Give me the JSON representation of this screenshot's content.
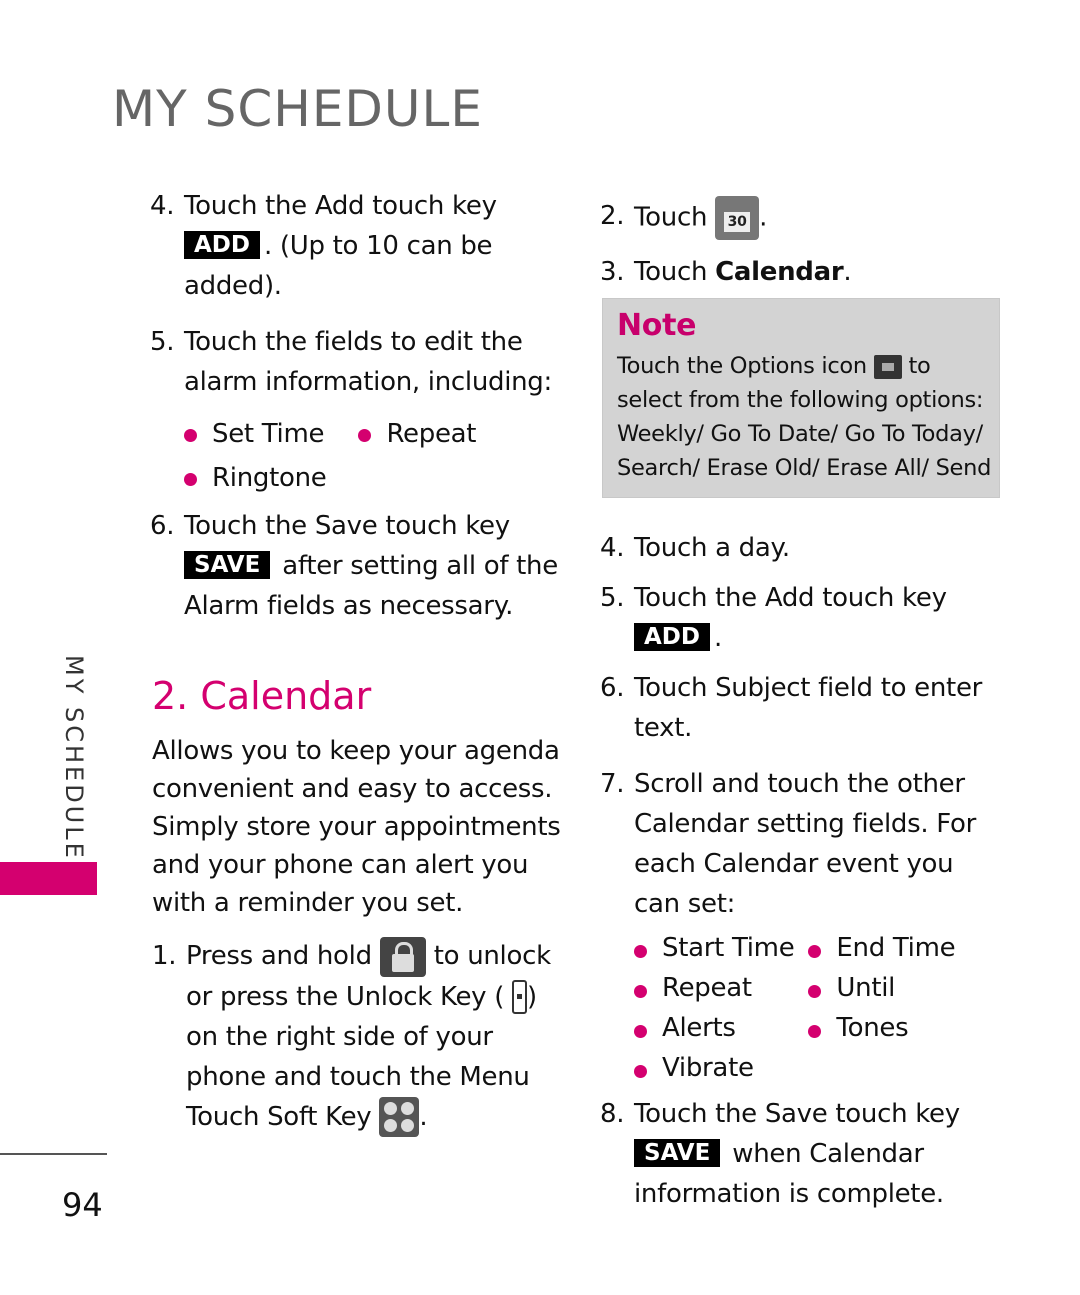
{
  "header": {
    "title": "MY SCHEDULE"
  },
  "sidebar": {
    "label": "MY SCHEDULE",
    "accent_color": "#d4006f"
  },
  "footer": {
    "page_number": "94"
  },
  "left_column": {
    "steps_top": [
      {
        "num": "4.",
        "text_before": "Touch the Add touch key",
        "key": "ADD",
        "text_after": ". (Up to 10 can be added)."
      },
      {
        "num": "5.",
        "text": "Touch the fields to edit the alarm information, including:",
        "bullets": [
          "Set Time",
          "Repeat",
          "Ringtone"
        ]
      },
      {
        "num": "6.",
        "text_before": "Touch the Save touch key",
        "key": "SAVE",
        "text_after": " after setting all of the Alarm fields as necessary."
      }
    ],
    "section_title": "2. Calendar",
    "intro": "Allows you to keep your agenda convenient and easy to access. Simply store your appointments and your phone can alert you with a reminder you set.",
    "step1": {
      "num": "1.",
      "part1": "Press and hold",
      "part2": " to unlock or press the Unlock Key (",
      "part3": ") on the right side of your phone and touch the Menu Touch Soft Key",
      "part4": "."
    }
  },
  "right_column": {
    "step2": {
      "num": "2.",
      "text": "Touch",
      "after": ".",
      "icon_label": "30"
    },
    "step3": {
      "num": "3.",
      "text": "Touch ",
      "bold": "Calendar",
      "after": "."
    },
    "note": {
      "title": "Note",
      "part1": "Touch the Options icon",
      "part2": " to select from the following options: Weekly/ Go To Date/ Go To Today/ Search/ Erase Old/ Erase All/ Send"
    },
    "step4": {
      "num": "4.",
      "text": "Touch a day."
    },
    "step5": {
      "num": "5.",
      "text": "Touch the Add touch key",
      "key": "ADD",
      "after": "."
    },
    "step6": {
      "num": "6.",
      "text": "Touch Subject field to enter text."
    },
    "step7": {
      "num": "7.",
      "text": "Scroll and touch the other Calendar setting fields. For each Calendar event you can set:",
      "bullets": [
        "Start Time",
        "End Time",
        "Repeat",
        "Until",
        "Alerts",
        "Tones",
        "Vibrate"
      ]
    },
    "step8": {
      "num": "8.",
      "text": "Touch the Save touch key",
      "key": "SAVE",
      "after": " when Calendar information is complete."
    }
  }
}
